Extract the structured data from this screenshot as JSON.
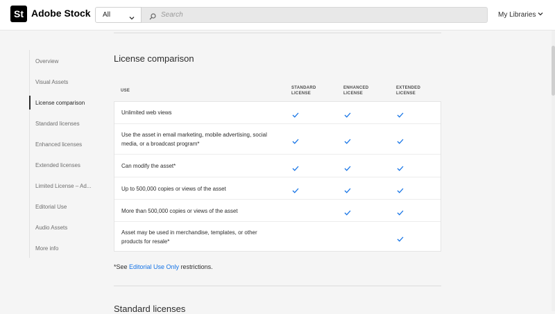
{
  "brand": {
    "badge": "St",
    "name": "Adobe Stock"
  },
  "search": {
    "filter_value": "All",
    "placeholder": "Search"
  },
  "header": {
    "my_libraries": "My Libraries"
  },
  "sidebar": {
    "items": [
      {
        "label": "Overview"
      },
      {
        "label": "Visual Assets"
      },
      {
        "label": "License comparison"
      },
      {
        "label": "Standard licenses"
      },
      {
        "label": "Enhanced licenses"
      },
      {
        "label": "Extended licenses"
      },
      {
        "label": "Limited License – Ad..."
      },
      {
        "label": "Editorial Use"
      },
      {
        "label": "Audio Assets"
      },
      {
        "label": "More info"
      }
    ],
    "active_index": 2
  },
  "section": {
    "title": "License comparison"
  },
  "table": {
    "headers": {
      "use": "USE",
      "standard_1": "STANDARD",
      "standard_2": "LICENSE",
      "enhanced_1": "ENHANCED",
      "enhanced_2": "LICENSE",
      "extended_1": "EXTENDED",
      "extended_2": "LICENSE"
    },
    "rows": [
      {
        "use": "Unlimited web views",
        "standard": true,
        "enhanced": true,
        "extended": true
      },
      {
        "use": "Use the asset in email marketing, mobile advertising, social media, or a broadcast program*",
        "standard": true,
        "enhanced": true,
        "extended": true
      },
      {
        "use": "Can modify the asset*",
        "standard": true,
        "enhanced": true,
        "extended": true
      },
      {
        "use": "Up to 500,000 copies or views of the asset",
        "standard": true,
        "enhanced": true,
        "extended": true
      },
      {
        "use": "More than 500,000 copies or views of the asset",
        "standard": false,
        "enhanced": true,
        "extended": true
      },
      {
        "use": "Asset may be used in merchandise, templates, or other products for resale*",
        "standard": false,
        "enhanced": false,
        "extended": true
      }
    ],
    "check_color": "#1473e6"
  },
  "footnote": {
    "prefix": "*See ",
    "link": "Editorial Use Only",
    "suffix": " restrictions."
  },
  "next_section": {
    "title": "Standard licenses"
  },
  "icons": {
    "check": "check-icon",
    "search": "search-icon",
    "chevron": "chevron-down-icon"
  }
}
